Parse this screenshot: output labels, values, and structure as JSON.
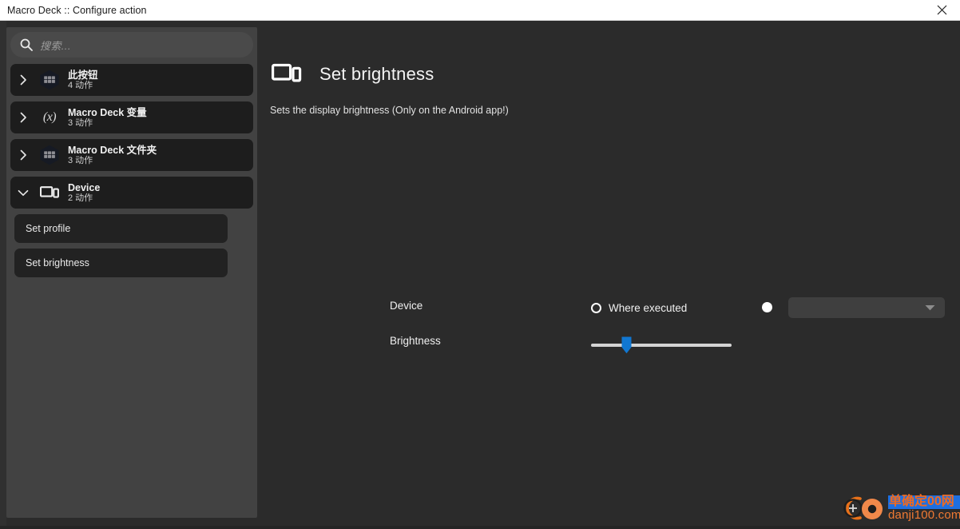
{
  "window": {
    "title": "Macro Deck :: Configure action",
    "close_icon": "close-icon"
  },
  "sidebar": {
    "search": {
      "placeholder": "搜索...",
      "value": "",
      "icon": "search-icon"
    },
    "groups": [
      {
        "title": "此按钮",
        "subtitle": "4 动作",
        "icon": "grid-hexagon-icon",
        "chevron": "chevron-right-icon",
        "expanded": false,
        "children": []
      },
      {
        "title": "Macro Deck 变量",
        "subtitle": "3 动作",
        "icon": "variable-icon",
        "chevron": "chevron-right-icon",
        "expanded": false,
        "children": []
      },
      {
        "title": "Macro Deck 文件夹",
        "subtitle": "3 动作",
        "icon": "grid-hexagon-icon",
        "chevron": "chevron-right-icon",
        "expanded": false,
        "children": []
      },
      {
        "title": "Device",
        "subtitle": "2 动作",
        "icon": "device-icon",
        "chevron": "chevron-down-icon",
        "expanded": true,
        "children": [
          {
            "label": "Set profile"
          },
          {
            "label": "Set brightness"
          }
        ]
      }
    ]
  },
  "main": {
    "icon": "device-icon",
    "title": "Set brightness",
    "description": "Sets the display brightness (Only on the Android app!)",
    "fields": {
      "device": {
        "label": "Device",
        "option_where_executed": "Where executed",
        "option_where_executed_selected": true,
        "option_specific_selected": false,
        "combo_value": "",
        "combo_arrow_icon": "chevron-down-icon"
      },
      "brightness": {
        "label": "Brightness",
        "value": 22,
        "min": 0,
        "max": 100
      }
    }
  },
  "watermark": {
    "cn_text": "单确定00网",
    "en_text": "danji100.com",
    "logo_icon": "danji-logo-icon"
  },
  "colors": {
    "titlebar_bg": "#ffffff",
    "window_bg": "#2b2b2b",
    "sidebar_bg": "#424242",
    "group_card_bg": "#1d1d1d",
    "leaf_card_bg": "#222222",
    "accent": "#1177d1",
    "text_primary": "#f1f1f1"
  }
}
